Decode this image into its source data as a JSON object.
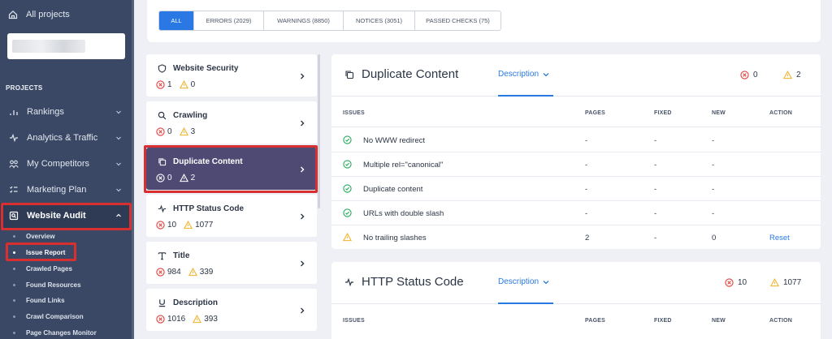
{
  "colors": {
    "sidebar": "#3a4865",
    "accent": "#2a78e4",
    "highlight": "#d83030",
    "active_card": "#4f4a74",
    "error": "#e0403d",
    "warning": "#f2b32b",
    "success": "#27a95c"
  },
  "sidebar": {
    "all_projects": "All projects",
    "section": "PROJECTS",
    "items": [
      {
        "label": "Rankings",
        "icon": "bar-chart-icon"
      },
      {
        "label": "Analytics & Traffic",
        "icon": "pulse-icon"
      },
      {
        "label": "My Competitors",
        "icon": "competitors-icon"
      },
      {
        "label": "Marketing Plan",
        "icon": "checklist-icon"
      },
      {
        "label": "Website Audit",
        "icon": "audit-icon"
      }
    ],
    "sub_items": [
      "Overview",
      "Issue Report",
      "Crawled Pages",
      "Found Resources",
      "Found Links",
      "Crawl Comparison",
      "Page Changes Monitor"
    ]
  },
  "filter_tabs": [
    {
      "label": "ALL",
      "active": true
    },
    {
      "label": "ERRORS (2029)"
    },
    {
      "label": "WARNINGS (8850)"
    },
    {
      "label": "NOTICES (3051)"
    },
    {
      "label": "PASSED CHECKS (75)"
    }
  ],
  "categories": [
    {
      "name": "Website Security",
      "icon": "shield-icon",
      "errors": "1",
      "warnings": "0"
    },
    {
      "name": "Crawling",
      "icon": "search-icon",
      "errors": "0",
      "warnings": "3"
    },
    {
      "name": "Duplicate Content",
      "icon": "copy-icon",
      "errors": "0",
      "warnings": "2",
      "active": true
    },
    {
      "name": "HTTP Status Code",
      "icon": "pulse-icon",
      "errors": "10",
      "warnings": "1077"
    },
    {
      "name": "Title",
      "icon": "title-icon",
      "errors": "984",
      "warnings": "339"
    },
    {
      "name": "Description",
      "icon": "underline-icon",
      "errors": "1016",
      "warnings": "393"
    }
  ],
  "panel_duplicate": {
    "title": "Duplicate Content",
    "description_label": "Description",
    "errors": "0",
    "warnings": "2",
    "columns": [
      "ISSUES",
      "PAGES",
      "FIXED",
      "NEW",
      "ACTION"
    ],
    "rows": [
      {
        "status": "ok",
        "issue": "No WWW redirect",
        "pages": "-",
        "fixed": "-",
        "new": "-",
        "action": ""
      },
      {
        "status": "ok",
        "issue": "Multiple rel=\"canonical\"",
        "pages": "-",
        "fixed": "-",
        "new": "-",
        "action": ""
      },
      {
        "status": "ok",
        "issue": "Duplicate content",
        "pages": "-",
        "fixed": "-",
        "new": "-",
        "action": ""
      },
      {
        "status": "ok",
        "issue": "URLs with double slash",
        "pages": "-",
        "fixed": "-",
        "new": "-",
        "action": ""
      },
      {
        "status": "warning",
        "issue": "No trailing slashes",
        "pages": "2",
        "fixed": "-",
        "new": "0",
        "action": "Reset"
      }
    ]
  },
  "panel_http": {
    "title": "HTTP Status Code",
    "description_label": "Description",
    "errors": "10",
    "warnings": "1077",
    "columns": [
      "ISSUES",
      "PAGES",
      "FIXED",
      "NEW",
      "ACTION"
    ]
  }
}
